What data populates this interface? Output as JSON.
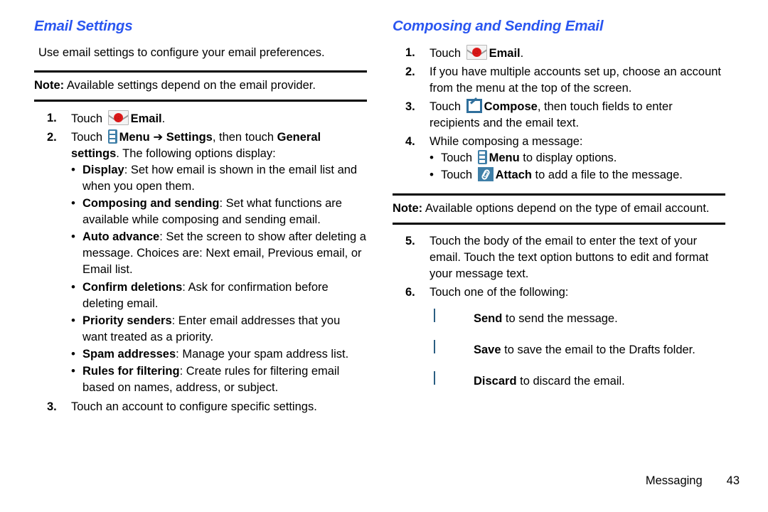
{
  "left_column": {
    "heading": "Email Settings",
    "intro": "Use email settings to configure your email preferences.",
    "note": {
      "label": "Note:",
      "text": " Available settings depend on the email provider."
    },
    "steps": [
      {
        "num": "1.",
        "pre": "Touch ",
        "icon": "email-icon",
        "bold": "Email",
        "post": "."
      },
      {
        "num": "2.",
        "pre": "Touch ",
        "icon": "menu-icon",
        "bold": "Menu",
        "arrow": "➔",
        "bold2": "Settings",
        "mid": ", then touch ",
        "bold3": "General settings",
        "post": ". The following options display:"
      },
      {
        "num": "3.",
        "pre": "Touch an account to configure specific settings.",
        "icon": "",
        "bold": "",
        "post": ""
      }
    ],
    "options": [
      {
        "term": "Display",
        "desc": ": Set how email is shown in the email list and when you open them."
      },
      {
        "term": "Composing and sending",
        "desc": ": Set what functions are available while composing and sending email."
      },
      {
        "term": "Auto advance",
        "desc": ": Set the screen to show after deleting a message. Choices are: Next email, Previous email, or Email list."
      },
      {
        "term": "Confirm deletions",
        "desc": ": Ask for confirmation before deleting email."
      },
      {
        "term": "Priority senders",
        "desc": ": Enter email addresses that you want treated as a priority."
      },
      {
        "term": "Spam addresses",
        "desc": ": Manage your spam address list."
      },
      {
        "term": "Rules for filtering",
        "desc": ": Create rules for filtering email based on names, address, or subject."
      }
    ]
  },
  "right_column": {
    "heading": "Composing and Sending Email",
    "steps": [
      {
        "num": "1.",
        "pre": "Touch ",
        "icon": "email-icon",
        "bold": "Email",
        "post": "."
      },
      {
        "num": "2.",
        "pre": "If you have multiple accounts set up, choose an account from the menu at the top of the screen.",
        "icon": "",
        "bold": "",
        "post": ""
      },
      {
        "num": "3.",
        "pre": "Touch ",
        "icon": "compose-icon",
        "bold": "Compose",
        "post": ", then touch fields to enter recipients and the email text."
      },
      {
        "num": "4.",
        "pre": "While composing a message:",
        "icon": "",
        "bold": "",
        "post": ""
      },
      {
        "num": "5.",
        "pre": "Touch the body of the email to enter the text of your email. Touch the text option buttons to edit and format your message text.",
        "icon": "",
        "bold": "",
        "post": ""
      },
      {
        "num": "6.",
        "pre": "Touch one of the following:",
        "icon": "",
        "bold": "",
        "post": ""
      }
    ],
    "compose_bullets": [
      {
        "pre": "Touch ",
        "icon": "menu-icon",
        "bold": "Menu",
        "post": " to display options."
      },
      {
        "pre": "Touch ",
        "icon": "attach-icon",
        "bold": "Attach",
        "post": " to add a file to the message."
      }
    ],
    "note": {
      "label": "Note:",
      "text": " Available options depend on the type of email account."
    },
    "actions": [
      {
        "icon": "send-icon",
        "bold": "Send",
        "desc": " to send the message."
      },
      {
        "icon": "save-icon",
        "bold": "Save",
        "desc": " to save the email to the Drafts folder."
      },
      {
        "icon": "discard-icon",
        "bold": "Discard",
        "desc": " to discard the email."
      }
    ]
  },
  "footer": {
    "section": "Messaging",
    "page": "43"
  },
  "colors": {
    "heading_blue": "#2A56F0",
    "icon_blue": "#3f7fa8",
    "email_red": "#e01b1b",
    "rule_black": "#000000"
  }
}
